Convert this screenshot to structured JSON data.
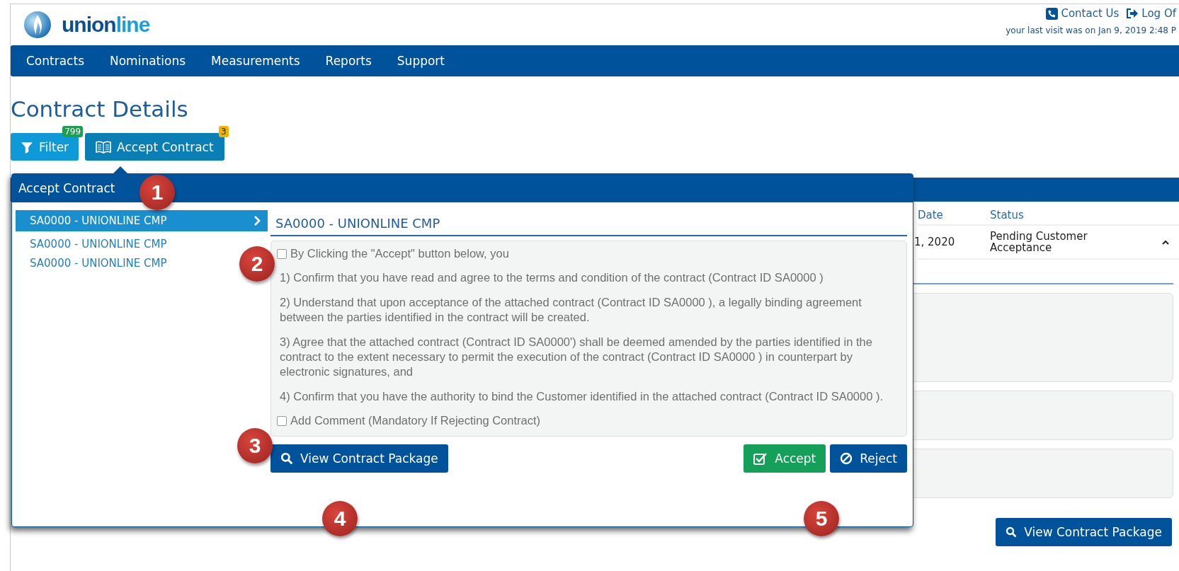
{
  "header": {
    "logo": {
      "dark": "union",
      "light": "line"
    },
    "links": [
      {
        "kind": "phone",
        "label": "Contact Us"
      },
      {
        "kind": "logoff",
        "label": "Log Of"
      }
    ],
    "last_visit": "your last visit was on Jan 9, 2019 2:48 P"
  },
  "nav": [
    "Contracts",
    "Nominations",
    "Measurements",
    "Reports",
    "Support"
  ],
  "page_title": "Contract Details",
  "toolbar": [
    {
      "kind": "filter",
      "label": "Filter",
      "badge": "799",
      "color": "#1e9e4f"
    },
    {
      "kind": "book",
      "label": "Accept Contract",
      "badge": "3",
      "color": "#f0b400"
    }
  ],
  "background": {
    "columns": [
      "Date",
      "Status"
    ],
    "row": [
      "1, 2020",
      "Pending Customer Acceptance"
    ],
    "button": "View Contract Package"
  },
  "popup": {
    "title": "Accept Contract",
    "contracts": [
      {
        "label": "SA0000 - UNIONLINE CMP",
        "selected": true
      },
      {
        "label": "SA0000 - UNIONLINE CMP",
        "selected": false
      },
      {
        "label": "SA0000 - UNIONLINE CMP",
        "selected": false
      }
    ],
    "detail_title": "SA0000 - UNIONLINE CMP",
    "accept_check": {
      "label": "By Clicking the \"Accept\" button below, you",
      "checked": false
    },
    "terms": [
      "1) Confirm that you have read and agree to the terms and condition of the contract (Contract ID  SA0000 )",
      "2) Understand that upon acceptance of the attached contract (Contract ID  SA0000 ), a legally binding agreement between the parties identified in the contract will be created.",
      "3) Agree that the attached contract (Contract ID   SA0000') shall be deemed amended by the parties identified in the contract to the extent necessary to permit the execution of the contract (Contract ID  SA0000 ) in counterpart by electronic signatures, and",
      "4) Confirm that you have the authority to bind the Customer identified in the attached contract (Contract ID SA0000 )."
    ],
    "comment_check": {
      "label": "Add Comment (Mandatory If Rejecting Contract)",
      "checked": false
    },
    "buttons": [
      {
        "kind": "view",
        "label": "View Contract Package"
      },
      {
        "kind": "accept",
        "label": "Accept"
      },
      {
        "kind": "reject",
        "label": "Reject"
      }
    ]
  },
  "callouts": [
    "1",
    "2",
    "3",
    "4",
    "5"
  ]
}
